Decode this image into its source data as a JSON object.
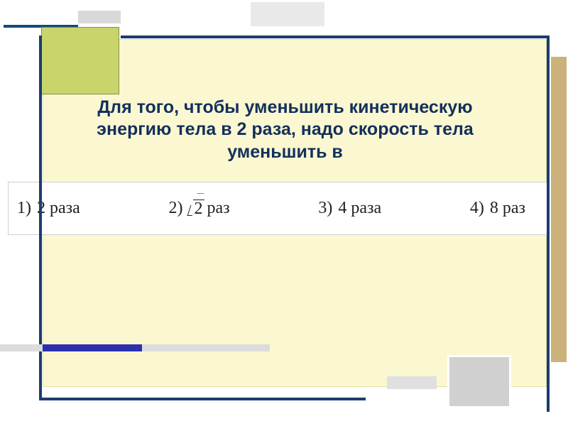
{
  "question": {
    "line1": "Для того, чтобы уменьшить кинетическую",
    "line2": "энергию тела в 2 раза, надо скорость тела",
    "line3": "уменьшить в"
  },
  "answers": {
    "a1_prefix": "1)",
    "a1_text": "2 раза",
    "a2_prefix": "2)",
    "a2_root_base": "2",
    "a2_suffix": "раз",
    "a3_prefix": "3)",
    "a3_text": "4 раза",
    "a4_prefix": "4)",
    "a4_text": "8 раз"
  }
}
